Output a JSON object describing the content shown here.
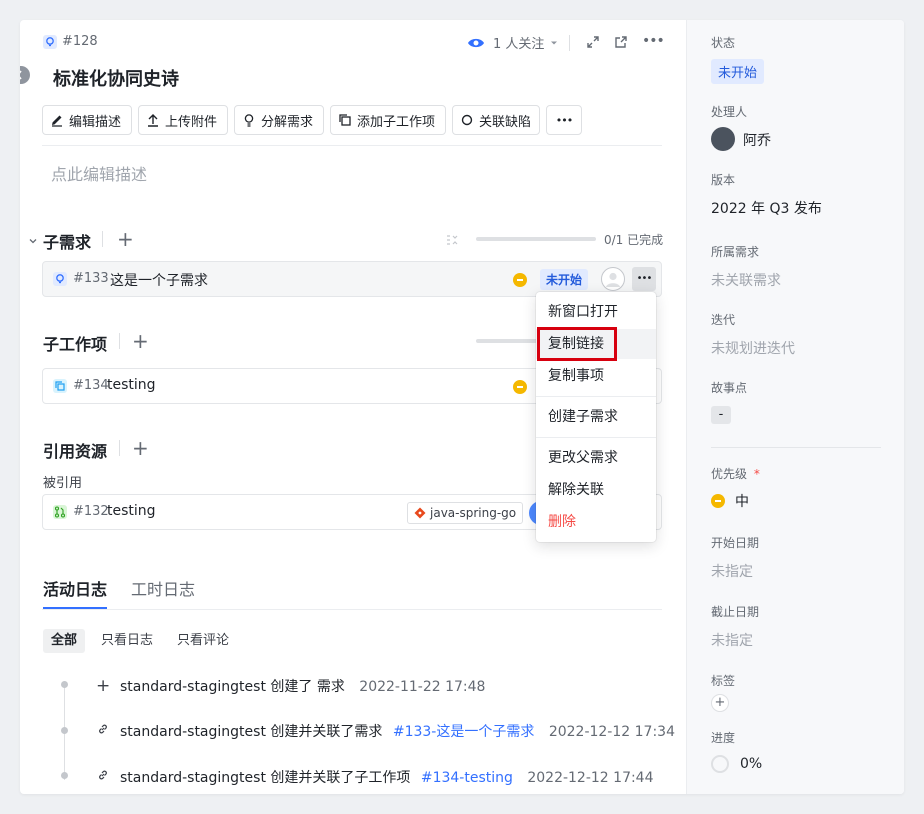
{
  "header": {
    "id": "#128",
    "watchers": "1 人关注",
    "title": "标准化协同史诗"
  },
  "toolbar": {
    "edit_desc": "编辑描述",
    "upload": "上传附件",
    "split": "分解需求",
    "add_sub": "添加子工作项",
    "link_bug": "关联缺陷",
    "more": "•••"
  },
  "description_placeholder": "点此编辑描述",
  "sub_requirements": {
    "title": "子需求",
    "progress_text": "0/1 已完成",
    "progress": 0,
    "item": {
      "id": "#133",
      "name": "这是一个子需求",
      "status": "未开始",
      "more": "•••"
    }
  },
  "sub_work_items": {
    "title": "子工作项",
    "item": {
      "id": "#134",
      "name": "testing"
    }
  },
  "references": {
    "title": "引用资源",
    "subtitle": "被引用",
    "item": {
      "id": "#132",
      "name": "testing",
      "repo": "java-spring-go"
    }
  },
  "context_menu": {
    "items": [
      "新窗口打开",
      "复制链接",
      "复制事项",
      "创建子需求",
      "更改父需求",
      "解除关联",
      "删除"
    ]
  },
  "tabs": {
    "activity": "活动日志",
    "worklog": "工时日志"
  },
  "filters": {
    "all": "全部",
    "logs_only": "只看日志",
    "comments_only": "只看评论"
  },
  "activity": [
    {
      "user": "standard-stagingtest",
      "action": "创建了 需求",
      "link": "",
      "time": "2022-11-22 17:48"
    },
    {
      "user": "standard-stagingtest",
      "action": "创建并关联了需求",
      "link": "#133-这是一个子需求",
      "time": "2022-12-12 17:34"
    },
    {
      "user": "standard-stagingtest",
      "action": "创建并关联了子工作项",
      "link": "#134-testing",
      "time": "2022-12-12 17:44"
    }
  ],
  "sidebar": {
    "status_label": "状态",
    "status": "未开始",
    "assignee_label": "处理人",
    "assignee": "阿乔",
    "version_label": "版本",
    "version": "2022 年 Q3 发布",
    "parent_label": "所属需求",
    "parent": "未关联需求",
    "iteration_label": "迭代",
    "iteration": "未规划进迭代",
    "points_label": "故事点",
    "points": "-",
    "priority_label": "优先级",
    "priority_required": "*",
    "priority": "中",
    "start_label": "开始日期",
    "start": "未指定",
    "due_label": "截止日期",
    "due": "未指定",
    "tags_label": "标签",
    "tags_add": "+",
    "progress_label": "进度",
    "progress": "0%"
  },
  "colors": {
    "accent": "#3370ff",
    "highlight_box": "#d7000f",
    "priority": "#f5b800",
    "danger": "#f54a45"
  }
}
